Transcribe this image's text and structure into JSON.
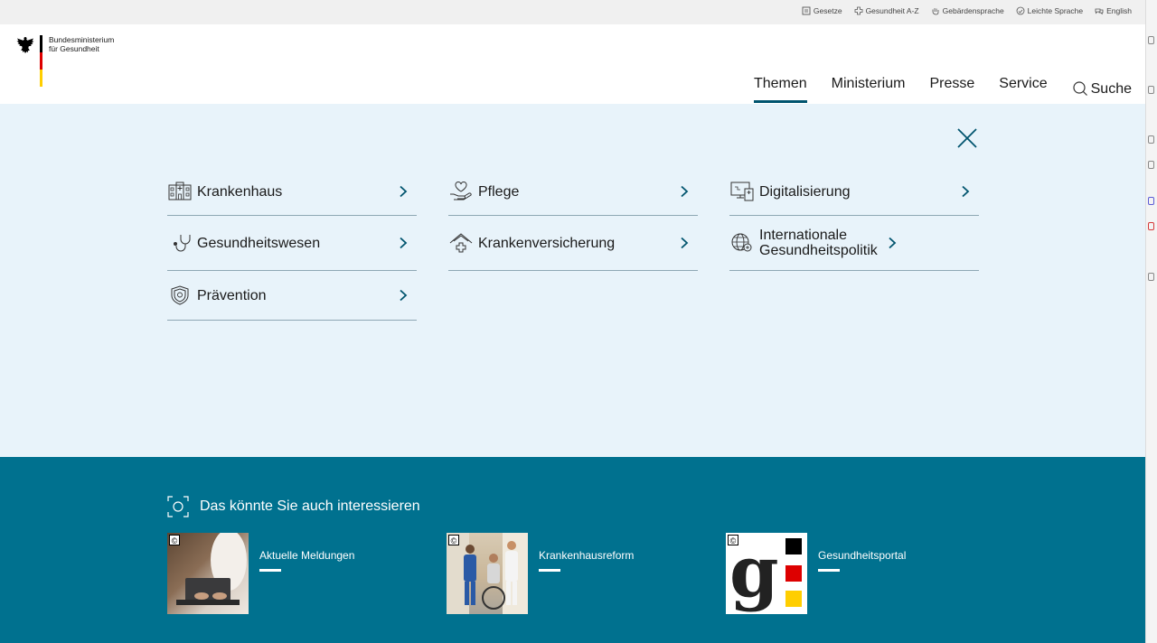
{
  "utility_links": [
    {
      "label": "Gesetze",
      "icon": "law-book-icon"
    },
    {
      "label": "Gesundheit A-Z",
      "icon": "health-cross-icon"
    },
    {
      "label": "Gebärdensprache",
      "icon": "sign-language-hand-icon"
    },
    {
      "label": "Leichte Sprache",
      "icon": "easy-language-icon"
    },
    {
      "label": "English",
      "icon": "english-language-icon"
    }
  ],
  "logo": {
    "line1": "Bundesministerium",
    "line2": "für Gesundheit"
  },
  "nav": {
    "items": [
      {
        "label": "Themen",
        "active": true
      },
      {
        "label": "Ministerium",
        "active": false
      },
      {
        "label": "Presse",
        "active": false
      },
      {
        "label": "Service",
        "active": false
      }
    ],
    "search_label": "Suche"
  },
  "flyout": {
    "columns": [
      [
        {
          "label": "Krankenhaus",
          "icon": "hospital-icon"
        },
        {
          "label": "Gesundheitswesen",
          "icon": "stethoscope-icon"
        },
        {
          "label": "Prävention",
          "icon": "shield-icon"
        }
      ],
      [
        {
          "label": "Pflege",
          "icon": "care-hand-heart-icon"
        },
        {
          "label": "Krankenversicherung",
          "icon": "insurance-house-cross-icon"
        }
      ],
      [
        {
          "label": "Digitalisierung",
          "icon": "digital-devices-icon"
        },
        {
          "label": "Internationale Gesundheitspolitik",
          "icon": "globe-icon"
        }
      ]
    ]
  },
  "teaser": {
    "heading": "Das könnte Sie auch interessieren",
    "cards": [
      {
        "label": "Aktuelle Meldungen"
      },
      {
        "label": "Krankenhausreform"
      },
      {
        "label": "Gesundheitsportal"
      }
    ],
    "copyright_symbol": "©"
  },
  "colors": {
    "accent": "#00546e",
    "flyout_bg": "#e8f3fa",
    "teaser_bg": "#00718f",
    "flag_black": "#000000",
    "flag_red": "#dd0000",
    "flag_gold": "#ffce00"
  }
}
